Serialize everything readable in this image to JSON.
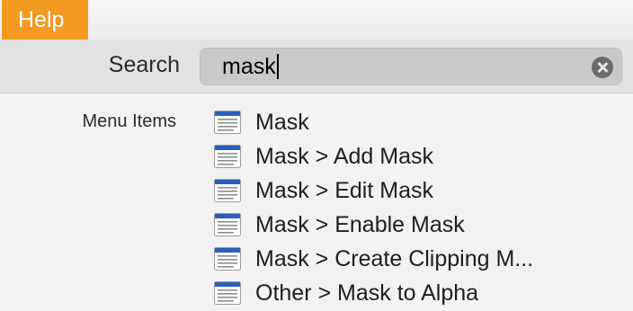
{
  "menubar": {
    "help_label": "Help"
  },
  "search": {
    "label": "Search",
    "value": "mask"
  },
  "results": {
    "section_label": "Menu Items",
    "items": [
      {
        "label": "Mask",
        "icon": "menu-item-icon"
      },
      {
        "label": "Mask > Add Mask",
        "icon": "menu-item-icon"
      },
      {
        "label": "Mask > Edit Mask",
        "icon": "menu-item-icon"
      },
      {
        "label": "Mask > Enable Mask",
        "icon": "menu-item-icon"
      },
      {
        "label": "Mask > Create Clipping M...",
        "icon": "menu-item-icon"
      },
      {
        "label": "Other > Mask to Alpha",
        "icon": "menu-item-icon"
      }
    ]
  },
  "colors": {
    "help_highlight": "#f39a23",
    "icon_blue": "#2c5fb8"
  }
}
